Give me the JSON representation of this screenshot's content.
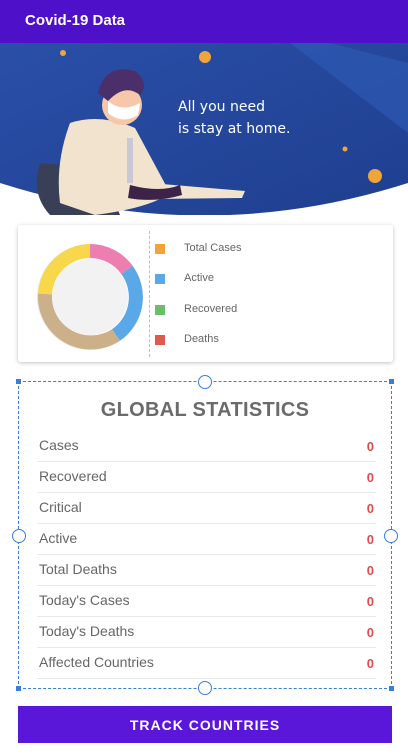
{
  "appbar": {
    "title": "Covid-19 Data"
  },
  "banner": {
    "line1": "All you need",
    "line2": "is stay at home."
  },
  "chart_data": {
    "type": "pie",
    "categories": [
      "Total Cases",
      "Active",
      "Recovered",
      "Deaths"
    ],
    "colors": [
      "#f3a33a",
      "#5aa8e8",
      "#6bbf6b",
      "#e05a4e"
    ]
  },
  "colors": {
    "primary": "#4e10c8",
    "value_red": "#e14c4c",
    "selection_blue": "#3b7ddd"
  },
  "stats": {
    "title": "GLOBAL STATISTICS",
    "rows": [
      {
        "label": "Cases",
        "value": "0"
      },
      {
        "label": "Recovered",
        "value": "0"
      },
      {
        "label": "Critical",
        "value": "0"
      },
      {
        "label": "Active",
        "value": "0"
      },
      {
        "label": "Total Deaths",
        "value": "0"
      },
      {
        "label": "Today's Cases",
        "value": "0"
      },
      {
        "label": "Today's Deaths",
        "value": "0"
      },
      {
        "label": "Affected Countries",
        "value": "0"
      }
    ]
  },
  "button": {
    "label": "TRACK COUNTRIES"
  }
}
